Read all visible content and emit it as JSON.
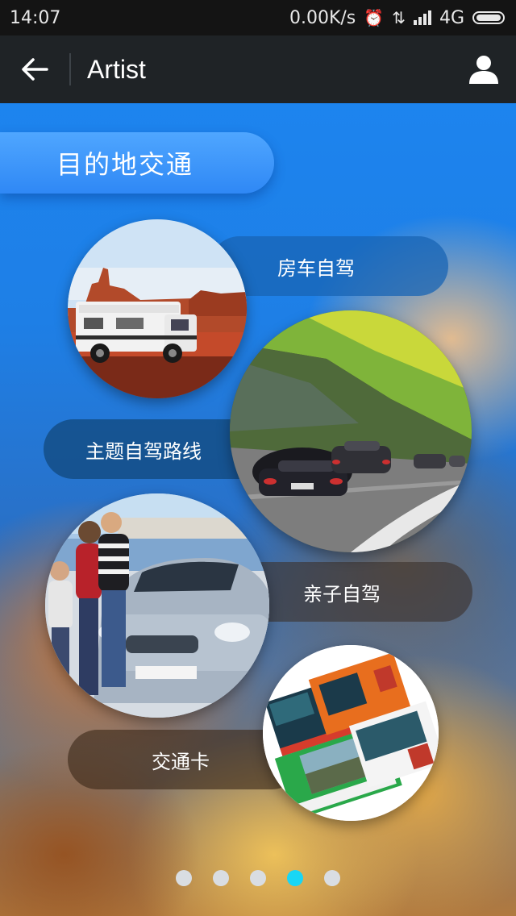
{
  "status_bar": {
    "time": "14:07",
    "net_speed": "0.00K/s",
    "network": "4G",
    "icons": [
      "alarm-icon",
      "data-arrows-icon",
      "signal-icon",
      "battery-icon"
    ]
  },
  "app_bar": {
    "title": "Artist",
    "back_icon": "back-arrow-icon",
    "user_icon": "user-icon"
  },
  "section": {
    "title": "目的地交通"
  },
  "items": [
    {
      "label": "房车自驾",
      "image": "rv-motorhome-photo"
    },
    {
      "label": "主题自驾路线",
      "image": "sports-cars-road-photo"
    },
    {
      "label": "亲子自驾",
      "image": "family-car-photo"
    },
    {
      "label": "交通卡",
      "image": "transit-cards-photo"
    }
  ],
  "pager": {
    "count": 5,
    "active_index": 3
  },
  "colors": {
    "accent": "#19d6f5",
    "app_bar": "#1f2326",
    "status_bar": "#141414",
    "section_pill": "#3a95fa"
  }
}
